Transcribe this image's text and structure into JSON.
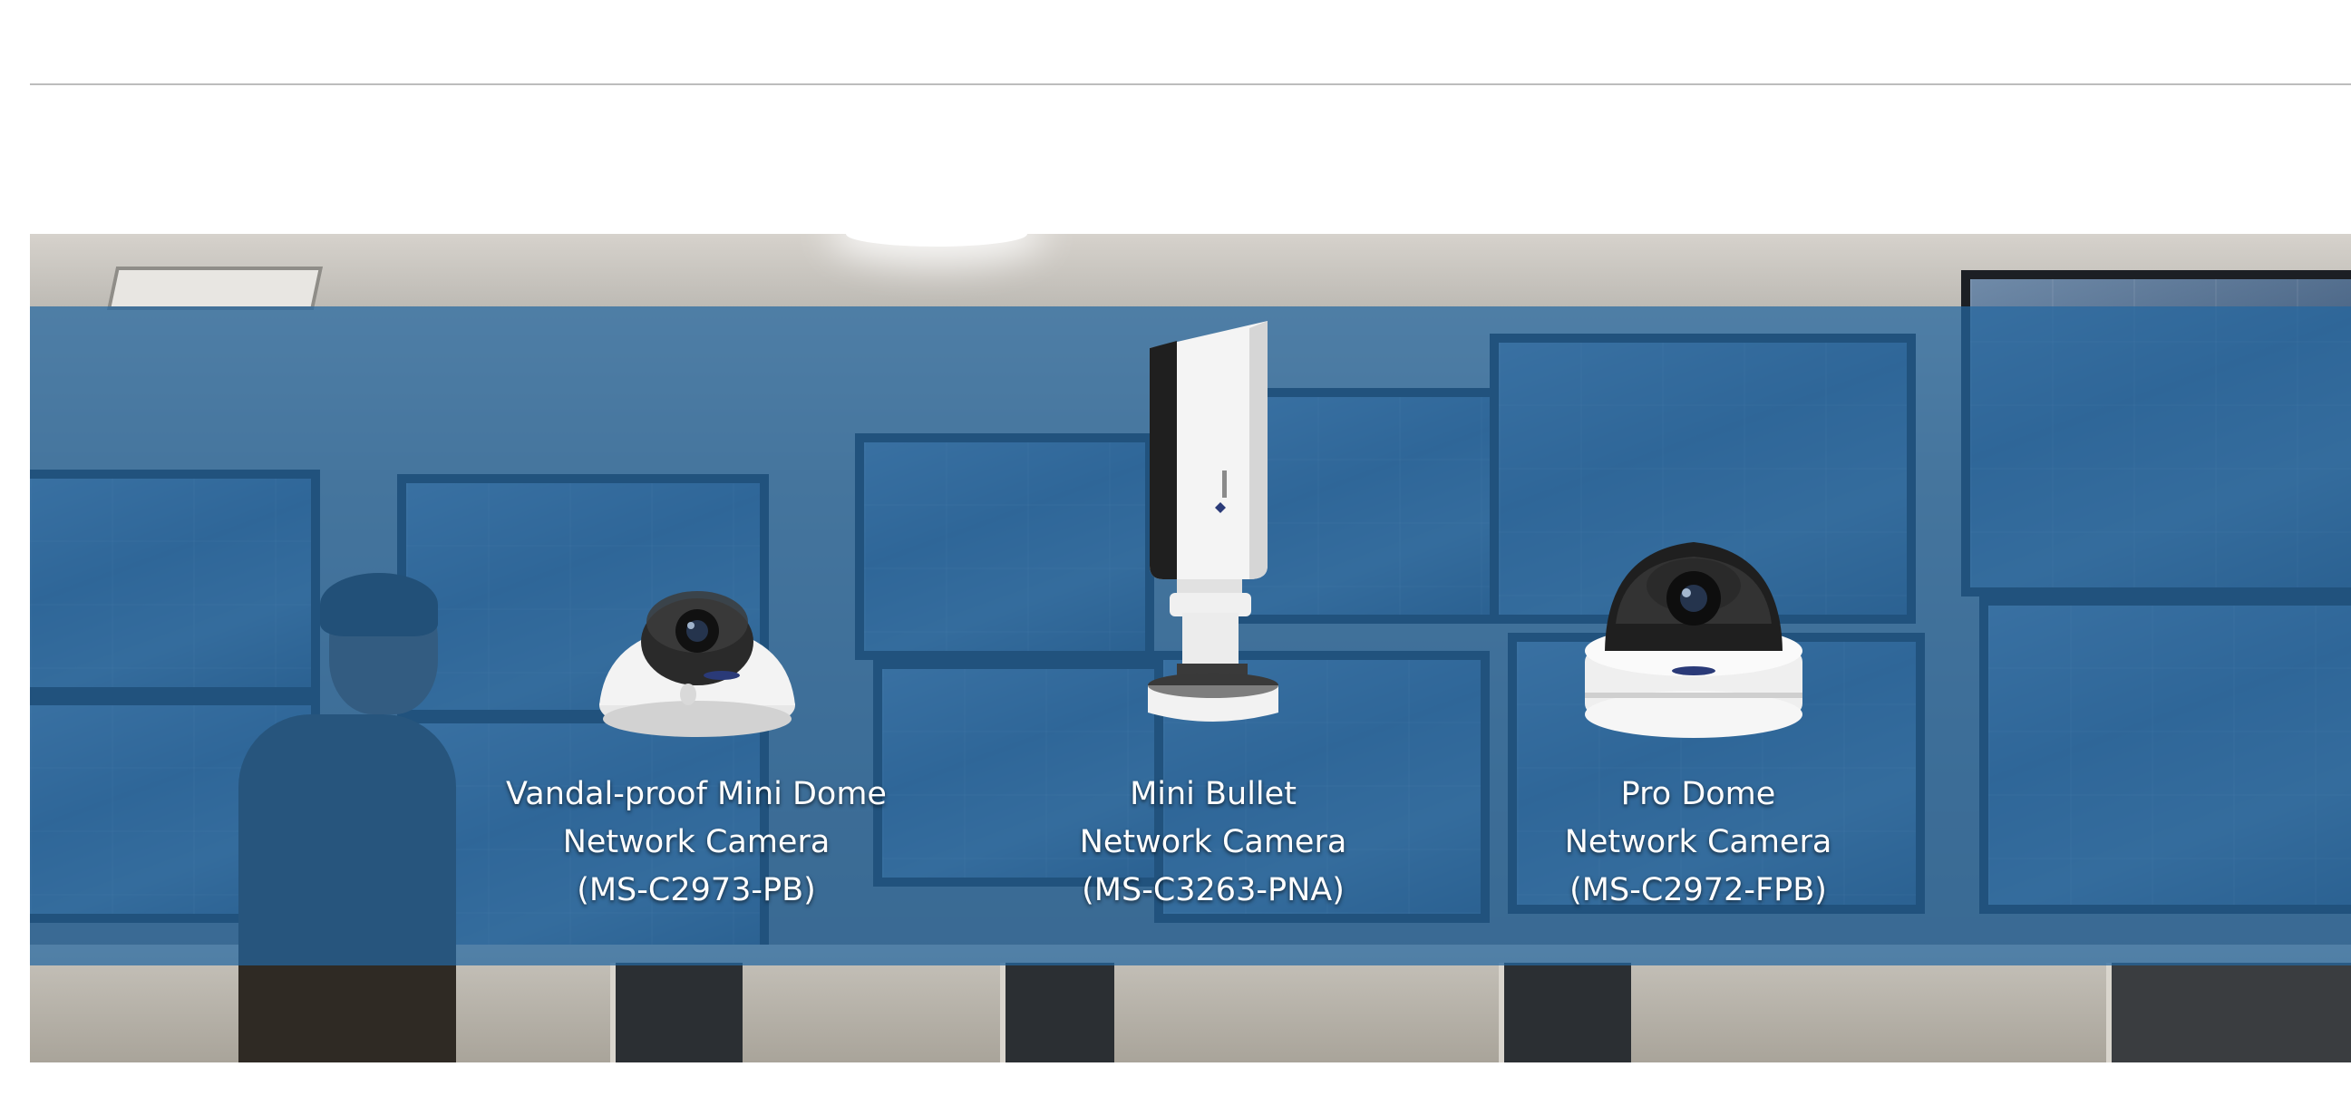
{
  "products": [
    {
      "name_line1": "Vandal-proof Mini Dome",
      "name_line2": "Network Camera",
      "model": "(MS-C2973-PB)",
      "icon": "mini-dome-camera-icon"
    },
    {
      "name_line1": "Mini Bullet",
      "name_line2": "Network Camera",
      "model": "(MS-C3263-PNA)",
      "icon": "mini-bullet-camera-icon"
    },
    {
      "name_line1": "Pro Dome",
      "name_line2": "Network Camera",
      "model": "(MS-C2972-FPB)",
      "icon": "pro-dome-camera-icon"
    }
  ],
  "colors": {
    "overlay": "#2466a0",
    "text": "#ffffff",
    "rule": "#bdbdbd"
  }
}
